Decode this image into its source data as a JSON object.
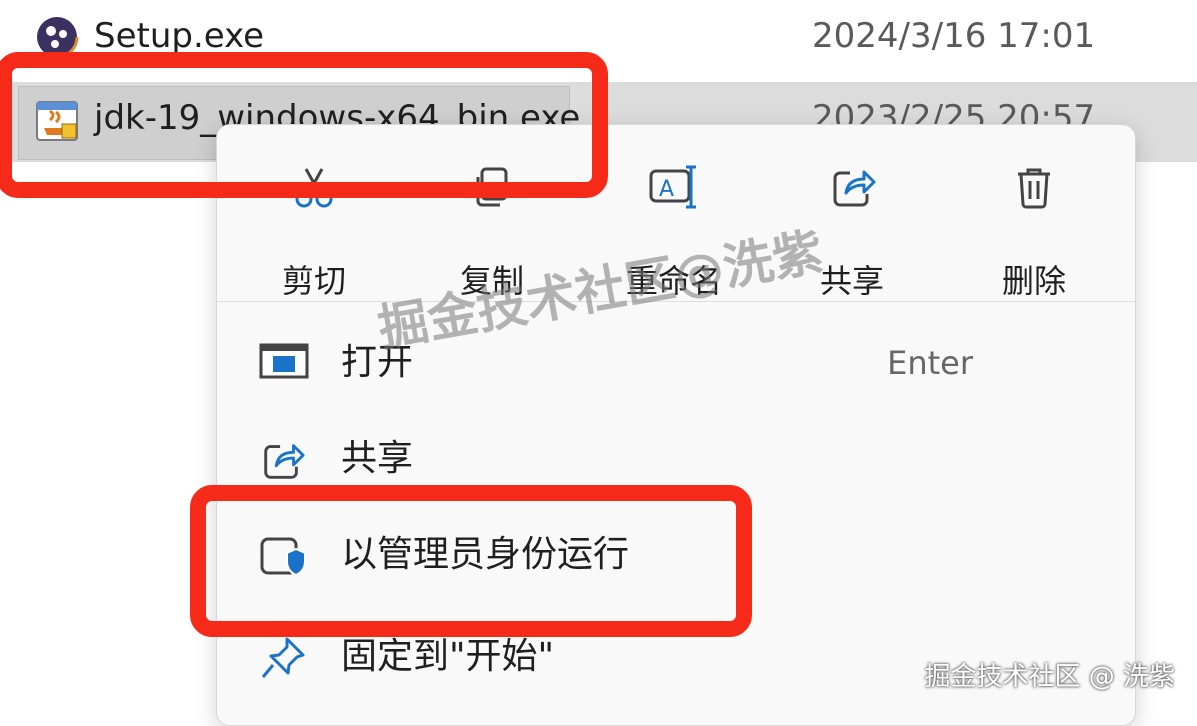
{
  "files": [
    {
      "name": "Setup.exe",
      "date": "2024/3/16 17:01",
      "icon": "setup-installer-icon"
    },
    {
      "name": "jdk-19_windows-x64_bin.exe",
      "date": "2023/2/25 20:57",
      "icon": "java-installer-icon"
    }
  ],
  "context_menu": {
    "quick_actions": [
      {
        "label": "剪切",
        "icon": "scissors-icon"
      },
      {
        "label": "复制",
        "icon": "copy-icon"
      },
      {
        "label": "重命名",
        "icon": "rename-icon"
      },
      {
        "label": "共享",
        "icon": "share-icon"
      },
      {
        "label": "删除",
        "icon": "trash-icon"
      }
    ],
    "items": [
      {
        "label": "打开",
        "shortcut": "Enter",
        "icon": "open-window-icon"
      },
      {
        "label": "共享",
        "icon": "share-icon"
      },
      {
        "label": "以管理员身份运行",
        "icon": "admin-shield-icon"
      },
      {
        "label": "固定到\"开始\"",
        "icon": "pin-icon"
      }
    ]
  },
  "watermark": {
    "center": "掘金技术社区@洗紫",
    "corner": "掘金技术社区 @ 洗紫"
  },
  "colors": {
    "highlight": "#f52a18",
    "selected_row": "#dcdcdc",
    "menu_bg": "#f9f9f9",
    "accent": "#1a73c8"
  }
}
